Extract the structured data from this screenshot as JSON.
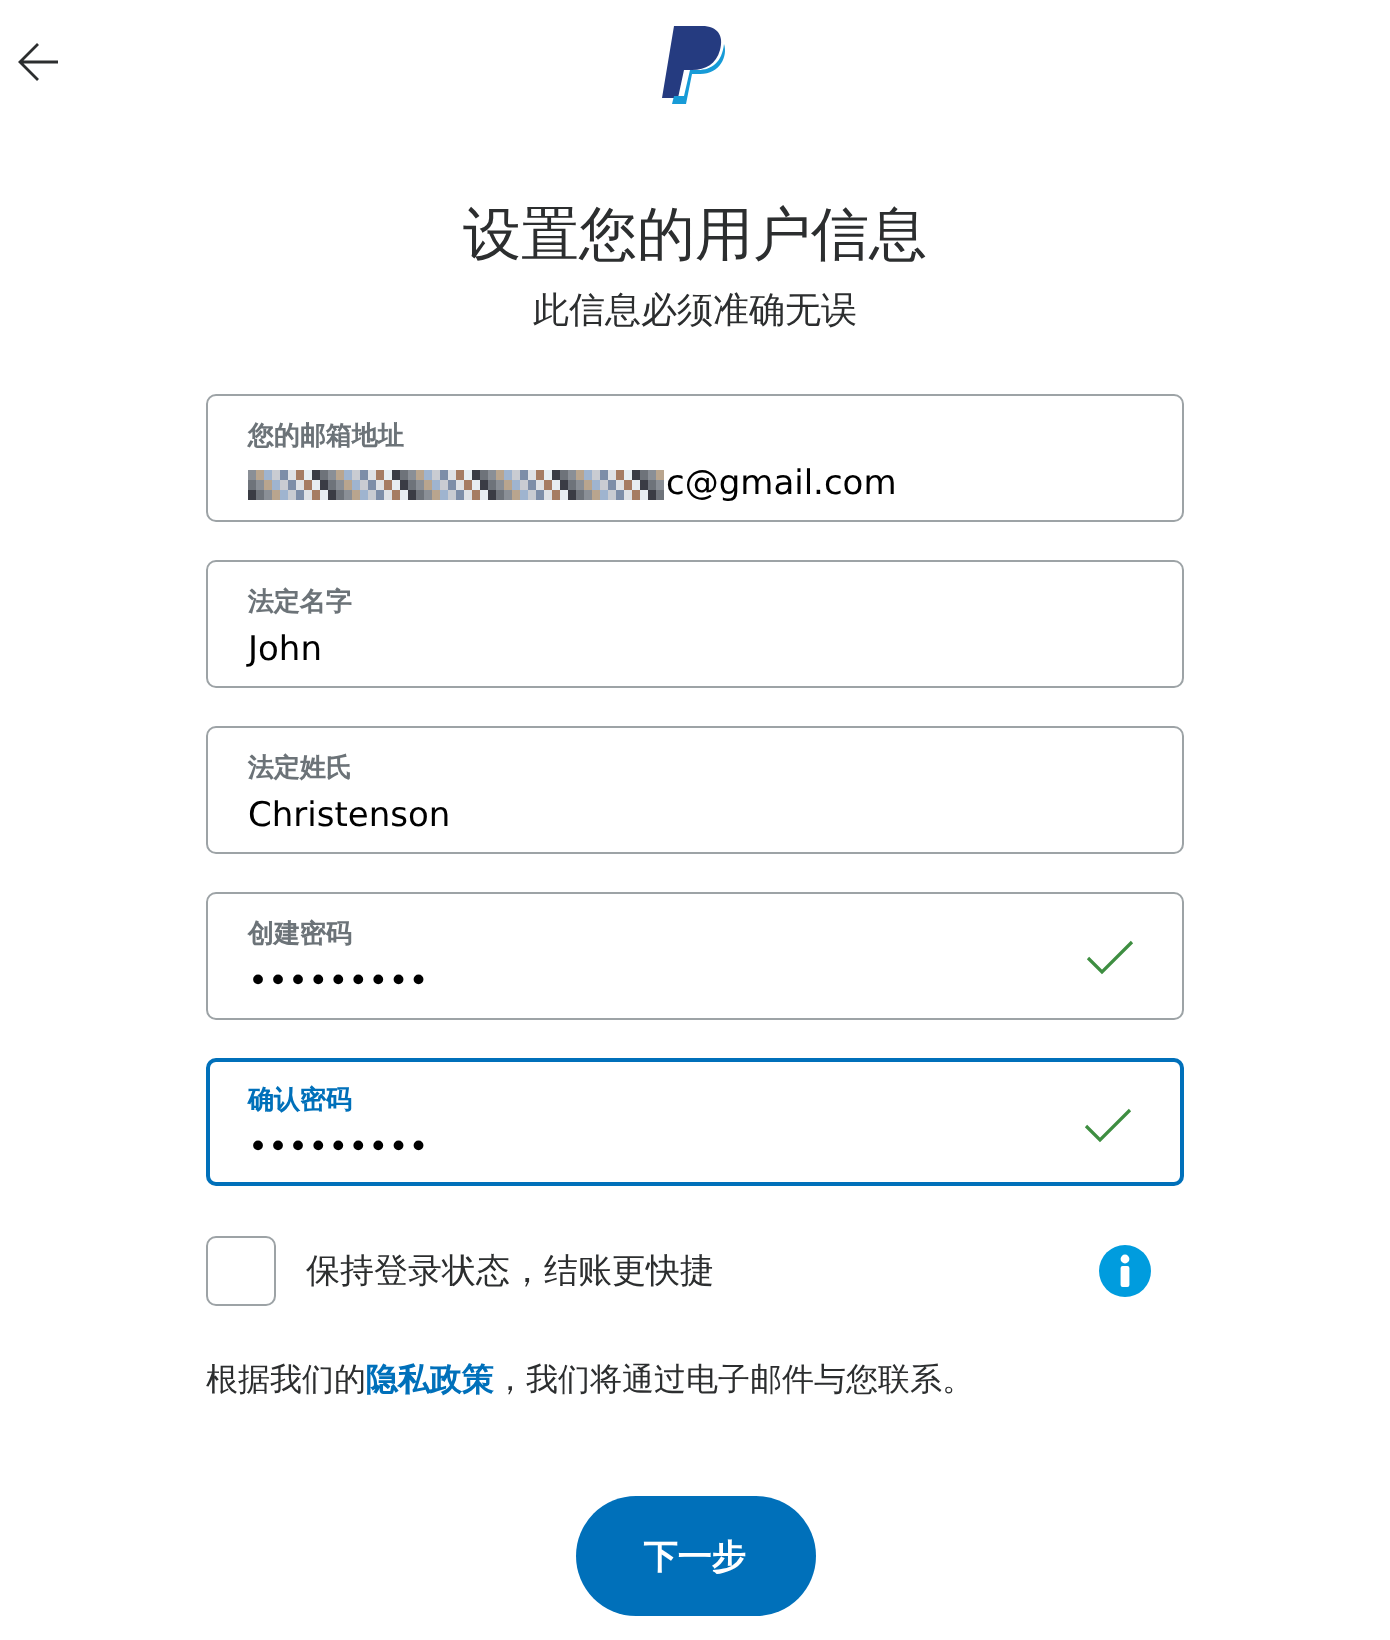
{
  "title": "设置您的用户信息",
  "subtitle": "此信息必须准确无误",
  "fields": [
    {
      "label": "您的邮箱地址",
      "value": "c@gmail.com",
      "redacted": true,
      "focused": false,
      "valid": false
    },
    {
      "label": "法定名字",
      "value": "John",
      "redacted": false,
      "focused": false,
      "valid": false
    },
    {
      "label": "法定姓氏",
      "value": "Christenson",
      "redacted": false,
      "focused": false,
      "valid": false
    },
    {
      "label": "创建密码",
      "value": "•••••••••",
      "redacted": false,
      "focused": false,
      "valid": true
    },
    {
      "label": "确认密码",
      "value": "•••••••••",
      "redacted": false,
      "focused": true,
      "valid": true
    }
  ],
  "remember": {
    "label": "保持登录状态，结账更快捷",
    "checked": false
  },
  "notice": {
    "before": "根据我们的",
    "link": "隐私政策",
    "after": "，我们将通过电子邮件与您联系。"
  },
  "next_button": "下一步"
}
